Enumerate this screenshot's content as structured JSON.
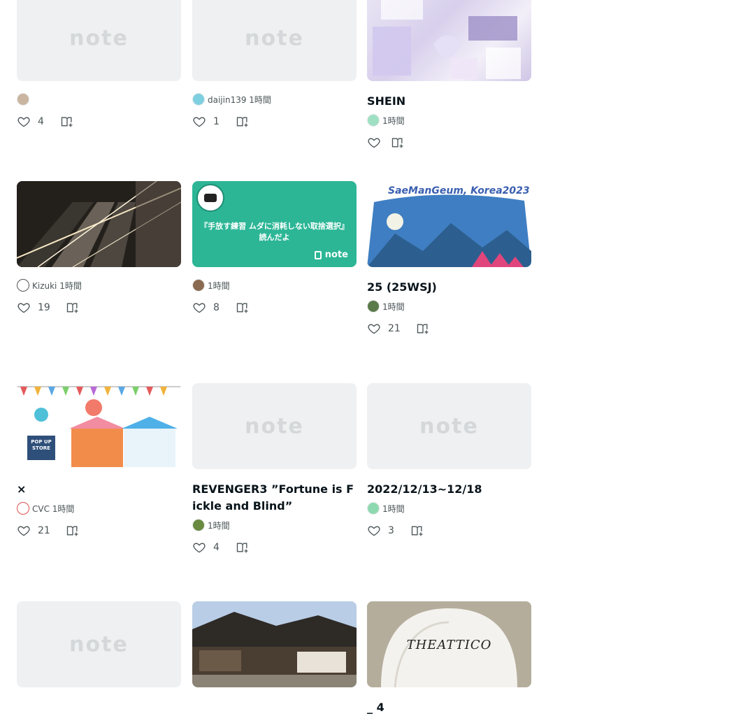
{
  "cards": [
    {
      "title": "",
      "author": "",
      "likes": "4",
      "thumb": "placeholder",
      "avatar_color": "#c9b5a0"
    },
    {
      "title": "",
      "author": "daijin139 1時間",
      "likes": "1",
      "thumb": "placeholder",
      "avatar_color": "#7ecfe0"
    },
    {
      "title": "SHEIN",
      "author": "1時間",
      "likes": "",
      "thumb": "shein",
      "avatar_color": "#9fe0c5"
    },
    {
      "title": "",
      "author": "Kizuki 1時間",
      "likes": "19",
      "thumb": "escalator",
      "avatar_color": "#555555"
    },
    {
      "title": "",
      "author": "1時間",
      "likes": "8",
      "thumb": "green-note",
      "avatar_color": "#8a6a50"
    },
    {
      "title": "25 (25WSJ)",
      "author": "1時間",
      "likes": "21",
      "thumb": "saemangeum",
      "avatar_color": "#5b7a4a"
    },
    {
      "title": "×",
      "author": "CVC 1時間",
      "likes": "21",
      "thumb": "popup",
      "avatar_color": "#e05050"
    },
    {
      "title": "REVENGER3 ”Fortune is Fickle and Blind”",
      "author": "1時間",
      "likes": "4",
      "thumb": "placeholder",
      "avatar_color": "#6a8a40"
    },
    {
      "title": "2022/12/13~12/18",
      "author": "1時間",
      "likes": "3",
      "thumb": "placeholder",
      "avatar_color": "#8fd9b0"
    },
    {
      "title": "",
      "author": "",
      "likes": "",
      "thumb": "placeholder",
      "avatar_color": "#cccccc"
    },
    {
      "title": "",
      "author": "",
      "likes": "",
      "thumb": "shrine",
      "avatar_color": "#cccccc"
    },
    {
      "title": "_ 4",
      "author": "",
      "likes": "",
      "thumb": "attico",
      "avatar_color": "#cccccc"
    }
  ],
  "placeholder_logo": "note",
  "green_note_text_1": "『手放す練習 ムダに消耗しない取捨選択』",
  "green_note_text_2": "読んだよ",
  "green_note_brand": "note",
  "saemangeum_text": "SaeManGeum, Korea2023",
  "popup_sign": "POP UP STORE",
  "attico_text": "THEATTICO",
  "colors": {
    "heart": "#4a5457",
    "placeholder_bg": "#eef0f1",
    "green_note_bg": "#2cb696"
  },
  "icons": {
    "like": "heart-icon",
    "save": "magazine-add-icon"
  }
}
